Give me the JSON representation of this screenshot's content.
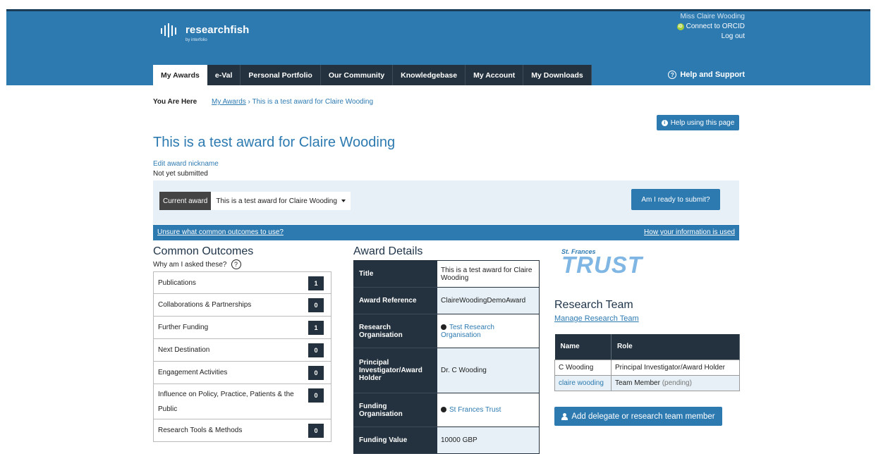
{
  "brand": {
    "name": "researchfish",
    "sub": "by interfolio"
  },
  "user": {
    "name": "Miss Claire Wooding",
    "orcid": "Connect to ORCID",
    "logout": "Log out"
  },
  "nav": {
    "tabs": [
      "My Awards",
      "e-Val",
      "Personal Portfolio",
      "Our Community",
      "Knowledgebase",
      "My Account",
      "My Downloads"
    ],
    "active": "My Awards",
    "help": "Help and Support"
  },
  "breadcrumb": {
    "label": "You Are Here",
    "link": "My Awards",
    "separator": "›",
    "current": "This is a test award for Claire Wooding"
  },
  "help_page_button": "Help using this page",
  "page": {
    "title": "This is a test award for Claire Wooding",
    "edit_nickname": "Edit award nickname",
    "status": "Not yet submitted"
  },
  "award_select": {
    "label": "Current award",
    "value": "This is a test award for Claire Wooding",
    "ready_button": "Am I ready to submit?"
  },
  "infobar": {
    "left": "Unsure what common outcomes to use?",
    "right": "How your information is used"
  },
  "common_outcomes": {
    "title": "Common Outcomes",
    "why": "Why am I asked these?",
    "items": [
      {
        "label": "Publications",
        "count": "1"
      },
      {
        "label": "Collaborations & Partnerships",
        "count": "0"
      },
      {
        "label": "Further Funding",
        "count": "1"
      },
      {
        "label": "Next Destination",
        "count": "0"
      },
      {
        "label": "Engagement Activities",
        "count": "0"
      },
      {
        "label": "Influence on Policy, Practice, Patients & the Public",
        "count": "0"
      },
      {
        "label": "Research Tools & Methods",
        "count": "0"
      }
    ]
  },
  "award_details": {
    "title": "Award Details",
    "rows": [
      {
        "key": "Title",
        "value": "This is a test award for Claire Wooding"
      },
      {
        "key": "Award Reference",
        "value": "ClaireWoodingDemoAward"
      },
      {
        "key": "Research Organisation",
        "value": "Test Research Organisation"
      },
      {
        "key": "Principal Investigator/Award Holder",
        "value": "Dr. C Wooding"
      },
      {
        "key": "Funding Organisation",
        "value": "St Frances Trust"
      },
      {
        "key": "Funding Value",
        "value": "10000 GBP"
      }
    ]
  },
  "funder_logo": {
    "small": "St. Frances",
    "big": "TRUST"
  },
  "research_team": {
    "title": "Research Team",
    "manage": "Manage Research Team",
    "headers": [
      "Name",
      "Role"
    ],
    "rows": [
      {
        "name": "C Wooding",
        "role": "Principal Investigator/Award Holder",
        "pending": ""
      },
      {
        "name": "claire wooding",
        "role": "Team Member",
        "pending": "(pending)"
      }
    ],
    "add_button": "Add delegate or research team member"
  },
  "colors": {
    "brand_blue": "#2d7ab1",
    "dark_navy": "#23323e",
    "light_panel": "#e6f0f6",
    "orcid_green": "#a6ce39"
  }
}
